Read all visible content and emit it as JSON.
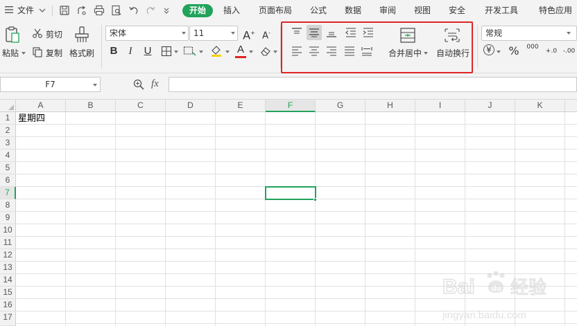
{
  "menubar": {
    "file_label": "文件",
    "tabs": [
      "开始",
      "插入",
      "页面布局",
      "公式",
      "数据",
      "审阅",
      "视图",
      "安全",
      "开发工具",
      "特色应用"
    ],
    "active_tab": "开始"
  },
  "ribbon": {
    "paste_label": "粘贴",
    "cut_label": "剪切",
    "copy_label": "复制",
    "format_painter_label": "格式刷",
    "font_name": "宋体",
    "font_size": "11",
    "grow_font": "A",
    "shrink_font": "A",
    "bold": "B",
    "italic": "I",
    "underline": "U",
    "font_color_glyph": "A",
    "merge_center_label": "合并居中",
    "wrap_text_label": "自动换行",
    "number_format": "常规",
    "currency_glyph": "¥",
    "percent_glyph": "%",
    "thousands_glyph": "000",
    "inc_decimal_glyph": "+.0",
    "dec_decimal_glyph": "-.00",
    "colors": {
      "accent": "#21a35b",
      "highlight_box": "#e02424",
      "font_color": "#e02424",
      "fill_color": "#f5d300"
    }
  },
  "formula_bar": {
    "name_box": "F7",
    "fx_label": "fx",
    "formula_value": ""
  },
  "sheet": {
    "columns": [
      "A",
      "B",
      "C",
      "D",
      "E",
      "F",
      "G",
      "H",
      "I",
      "J",
      "K"
    ],
    "rows": [
      "1",
      "2",
      "3",
      "4",
      "5",
      "6",
      "7",
      "8",
      "9",
      "10",
      "11",
      "12",
      "13",
      "14",
      "15",
      "16",
      "17"
    ],
    "selected_column": "F",
    "selected_row": "7",
    "cells": {
      "A1": "星期四"
    }
  },
  "watermark": {
    "brand": "Bai du",
    "chinese": "经验",
    "url": "jingyan.baidu.com"
  }
}
